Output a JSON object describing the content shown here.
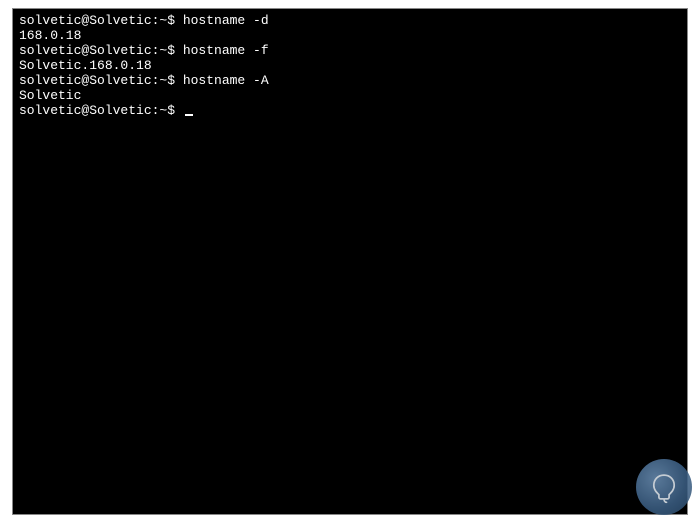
{
  "terminal": {
    "lines": [
      {
        "prompt": "solvetic@Solvetic:~$ ",
        "command": "hostname -d"
      },
      {
        "output": "168.0.18"
      },
      {
        "prompt": "solvetic@Solvetic:~$ ",
        "command": "hostname -f"
      },
      {
        "output": "Solvetic.168.0.18"
      },
      {
        "prompt": "solvetic@Solvetic:~$ ",
        "command": "hostname -A"
      },
      {
        "output": "Solvetic"
      },
      {
        "prompt": "solvetic@Solvetic:~$ ",
        "command": ""
      }
    ]
  },
  "watermark": {
    "name": "solvetic-logo"
  }
}
